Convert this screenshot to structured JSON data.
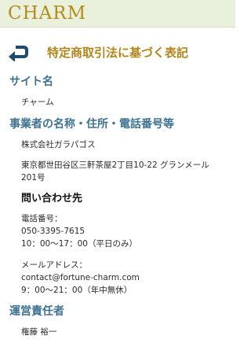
{
  "header": {
    "logo": "CHARM"
  },
  "page": {
    "title": "特定商取引法に基づく表記"
  },
  "icons": {
    "back": "back-arrow-icon"
  },
  "colors": {
    "accent": "#b0861a",
    "section_heading": "#3e7291",
    "header_bg": "#e9f0dc"
  },
  "site_name": {
    "heading": "サイト名",
    "value": "チャーム"
  },
  "business": {
    "heading": "事業者の名称・住所・電話番号等",
    "company": "株式会社ガラパゴス",
    "address_line1": "東京都世田谷区三軒茶屋2丁目10-22 グランメール",
    "address_line2": "201号"
  },
  "contact": {
    "heading": "問い合わせ先",
    "phone_label": "電話番号：",
    "phone": "050-3395-7615",
    "phone_hours": "10：00〜17：00（平日のみ）",
    "email_label": "メールアドレス：",
    "email": "contact@fortune-charm.com",
    "email_hours": "9：00〜21：00（年中無休）"
  },
  "manager": {
    "heading": "運営責任者",
    "name": "権藤 裕一"
  }
}
